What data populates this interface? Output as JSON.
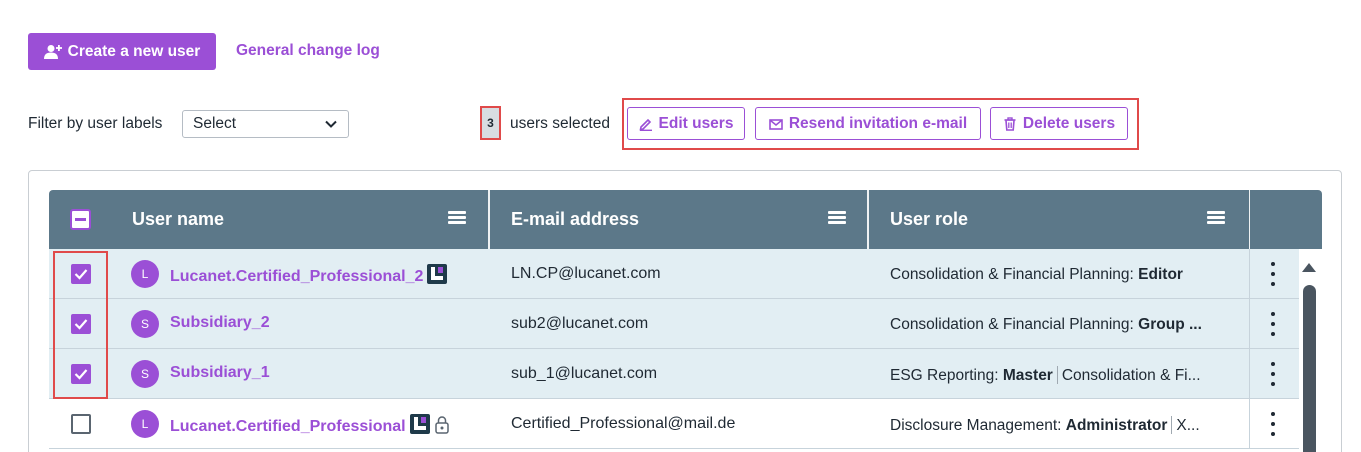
{
  "toolbar": {
    "create_label": "Create a new user",
    "changelog_label": "General change log"
  },
  "filter": {
    "label": "Filter by user labels",
    "select_value": "Select"
  },
  "selection": {
    "count": "3",
    "label": "users selected",
    "edit_label": "Edit users",
    "resend_label": "Resend invitation e-mail",
    "delete_label": "Delete users"
  },
  "table": {
    "columns": [
      "User name",
      "E-mail address",
      "User role"
    ],
    "rows": [
      {
        "avatar": "L",
        "name": "Lucanet.Certified_Professional_2",
        "email": "LN.CP@lucanet.com",
        "role_area": "Consolidation & Financial Planning:",
        "role_level": "Editor",
        "role_more": "",
        "role_more_level": "",
        "checked": true
      },
      {
        "avatar": "S",
        "name": "Subsidiary_2",
        "email": "sub2@lucanet.com",
        "role_area": "Consolidation & Financial Planning:",
        "role_level": "Group ...",
        "role_more": "",
        "role_more_level": "",
        "checked": true
      },
      {
        "avatar": "S",
        "name": "Subsidiary_1",
        "email": "sub_1@lucanet.com",
        "role_area": "ESG Reporting:",
        "role_level": "Master",
        "role_more": "Consolidation & Fi...",
        "role_more_level": "",
        "checked": true
      },
      {
        "avatar": "L",
        "name": "Lucanet.Certified_Professional",
        "email": "Certified_Professional@mail.de",
        "role_area": "Disclosure Management:",
        "role_level": "Administrator",
        "role_more": "X...",
        "role_more_level": "",
        "checked": false
      }
    ]
  },
  "colors": {
    "accent": "#9b4fd6",
    "header": "#5c7889",
    "selected_row": "#e2eef3",
    "highlight": "#e04a4a"
  }
}
